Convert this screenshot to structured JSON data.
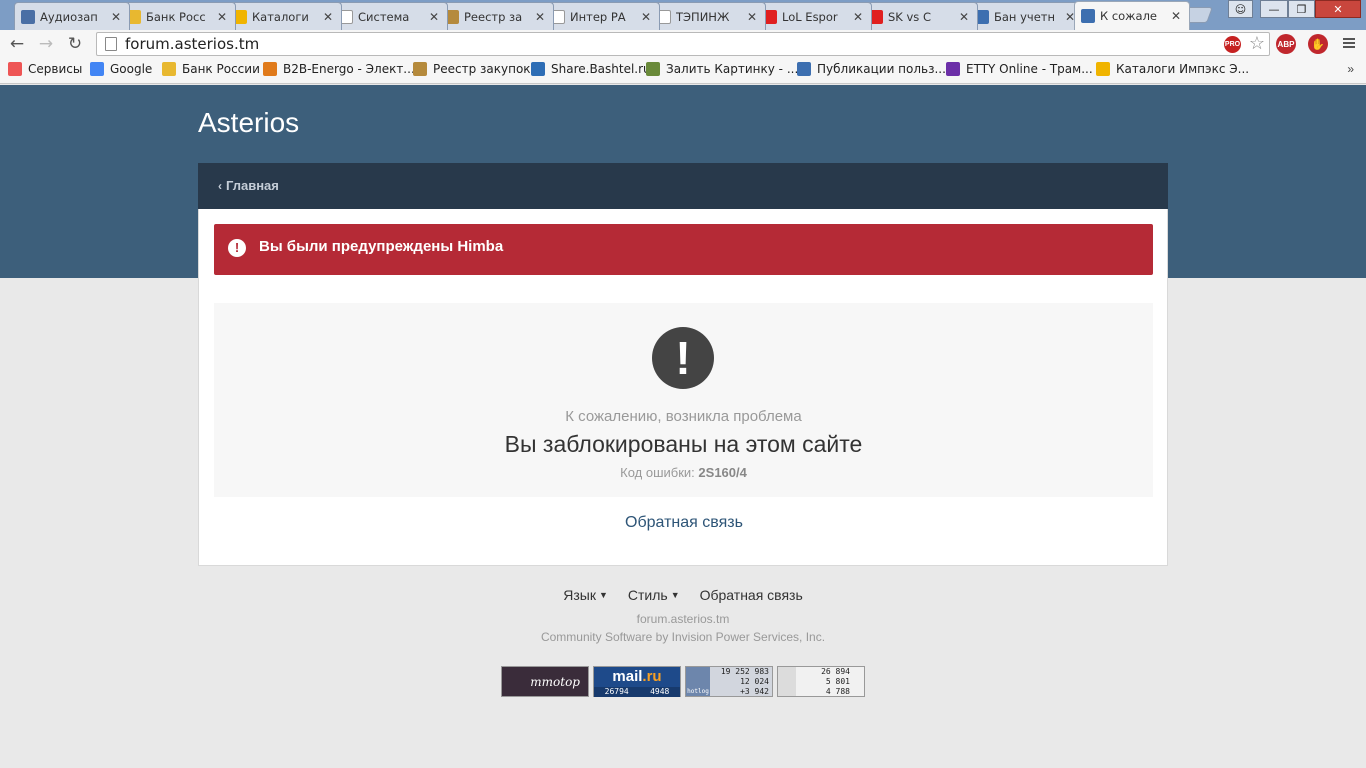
{
  "browser": {
    "tabs": [
      {
        "title": "Аудиозап",
        "favicon": "pause-icon",
        "color": "#4a6fa5"
      },
      {
        "title": "Банк Росс",
        "favicon": "bank-russia-icon",
        "color": "#e8b830"
      },
      {
        "title": "Каталоги",
        "favicon": "cloud-icon",
        "color": "#f0b400"
      },
      {
        "title": "Система",
        "favicon": "page-icon",
        "color": "#ffffff"
      },
      {
        "title": "Реестр за",
        "favicon": "emblem-icon",
        "color": "#b58a3c"
      },
      {
        "title": "Интер РА",
        "favicon": "page-icon",
        "color": "#ffffff"
      },
      {
        "title": "ТЭПИНЖ",
        "favicon": "page-icon",
        "color": "#ffffff"
      },
      {
        "title": "LoL Espor",
        "favicon": "youtube-icon",
        "color": "#e02020"
      },
      {
        "title": "SK vs C",
        "favicon": "youtube-icon",
        "color": "#e02020"
      },
      {
        "title": "Бан учетн",
        "favicon": "vk-check-icon",
        "color": "#3d6fb0"
      },
      {
        "title": "К сожале",
        "favicon": "vk-check-icon",
        "color": "#3d6fb0"
      }
    ],
    "close_glyph": "✕",
    "url": "forum.asterios.tm",
    "pro_badge": "PRO",
    "abp_badge": "ABP",
    "bookmarks": [
      {
        "label": "Сервисы",
        "icon": "apps-grid-icon"
      },
      {
        "label": "Google",
        "icon": "google-icon"
      },
      {
        "label": "Банк России",
        "icon": "bank-russia-icon"
      },
      {
        "label": "B2B-Energo - Элект...",
        "icon": "b2b-icon"
      },
      {
        "label": "Реестр закупок",
        "icon": "emblem-icon"
      },
      {
        "label": "Share.Bashtel.ru",
        "icon": "share-icon"
      },
      {
        "label": "Залить Картинку - ...",
        "icon": "image-icon"
      },
      {
        "label": "Публикации польз...",
        "icon": "vk-check-icon"
      },
      {
        "label": "ETTY Online - Трам...",
        "icon": "etty-icon"
      },
      {
        "label": "Каталоги Импэкс Э...",
        "icon": "cloud-icon"
      }
    ],
    "more_glyph": "»"
  },
  "site": {
    "title": "Asterios",
    "breadcrumb": "Главная",
    "warning": "Вы были предупреждены Himba",
    "error_subtitle": "К сожалению, возникла проблема",
    "error_title": "Вы заблокированы на этом сайте",
    "error_code_label": "Код ошибки:",
    "error_code": "2S160/4",
    "feedback_link": "Обратная связь"
  },
  "footer": {
    "language": "Язык",
    "style": "Стиль",
    "feedback": "Обратная связь",
    "domain": "forum.asterios.tm",
    "credit": "Community Software by Invision Power Services, Inc."
  },
  "counters": {
    "mmotop": {
      "label": "mmotop"
    },
    "mail": {
      "logo_a": "mail",
      "logo_b": ".ru",
      "v1": "26794",
      "v2": "4948"
    },
    "hotlog": {
      "label": "hotlog",
      "v1": "19 252 983",
      "v2": "12 024",
      "v3": "+3 942"
    },
    "liveinternet": {
      "v1": "26 894",
      "v2": "5 801",
      "v3": "4 788"
    }
  },
  "colors": {
    "hero": "#3d5f7b",
    "breadcrumb_bar": "#28394b",
    "warning": "#b52a36",
    "link": "#2e5577"
  }
}
